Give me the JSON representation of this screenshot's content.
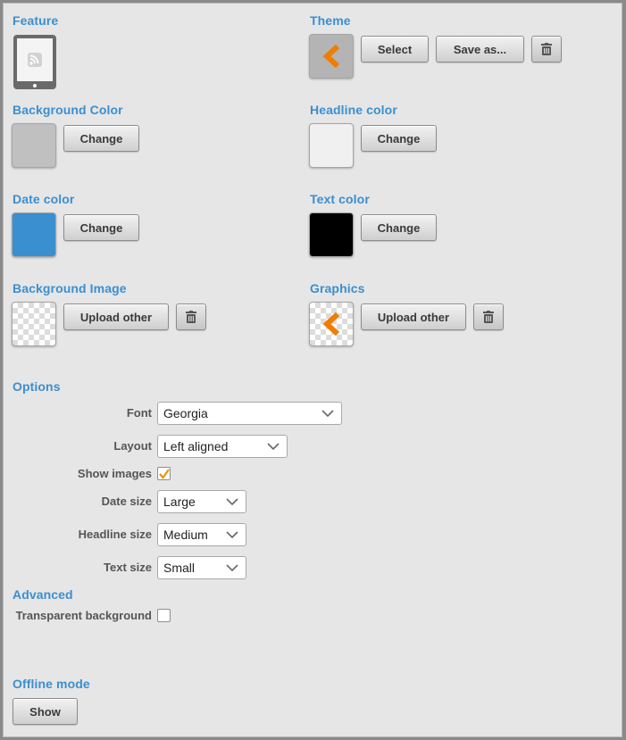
{
  "feature": {
    "title": "Feature",
    "icon": "rss-tablet-icon"
  },
  "theme": {
    "title": "Theme",
    "icon": "chevron-left-orange-icon",
    "select_label": "Select",
    "save_as_label": "Save as...",
    "delete_icon": "trash-icon"
  },
  "background_color": {
    "title": "Background Color",
    "color": "#c0c0c0",
    "change_label": "Change"
  },
  "headline_color": {
    "title": "Headline color",
    "color": "#f0f0f0",
    "change_label": "Change"
  },
  "date_color": {
    "title": "Date color",
    "color": "#3a8fd0",
    "change_label": "Change"
  },
  "text_color": {
    "title": "Text color",
    "color": "#000000",
    "change_label": "Change"
  },
  "background_image": {
    "title": "Background Image",
    "upload_label": "Upload other",
    "delete_icon": "trash-icon"
  },
  "graphics": {
    "title": "Graphics",
    "upload_label": "Upload other",
    "delete_icon": "trash-icon",
    "icon": "chevron-left-orange-icon"
  },
  "options": {
    "title": "Options",
    "font": {
      "label": "Font",
      "value": "Georgia"
    },
    "layout": {
      "label": "Layout",
      "value": "Left aligned"
    },
    "show_images": {
      "label": "Show images",
      "checked": true
    },
    "date_size": {
      "label": "Date size",
      "value": "Large"
    },
    "headline_size": {
      "label": "Headline size",
      "value": "Medium"
    },
    "text_size": {
      "label": "Text size",
      "value": "Small"
    }
  },
  "advanced": {
    "title": "Advanced",
    "transparent_background": {
      "label": "Transparent background",
      "checked": false
    }
  },
  "offline": {
    "title": "Offline mode",
    "show_label": "Show"
  },
  "colors": {
    "accent": "#3a8fd0",
    "orange": "#f07d00"
  }
}
